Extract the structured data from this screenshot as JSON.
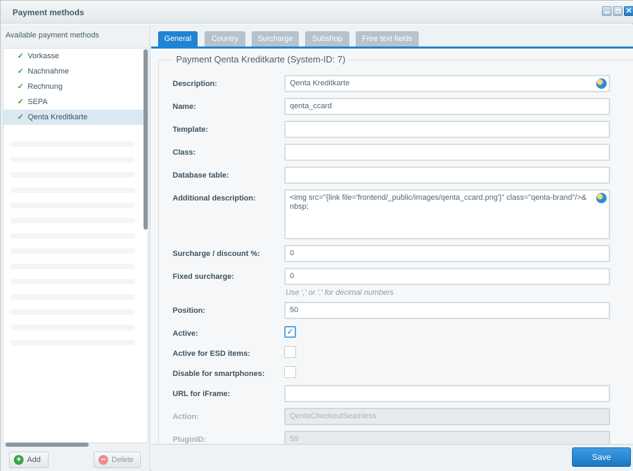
{
  "window": {
    "title": "Payment methods"
  },
  "left_panel": {
    "heading": "Available payment methods",
    "items": [
      {
        "label": "Vorkasse"
      },
      {
        "label": "Nachnahme"
      },
      {
        "label": "Rechnung"
      },
      {
        "label": "SEPA"
      },
      {
        "label": "Qenta Kreditkarte"
      }
    ],
    "add_label": "Add",
    "delete_label": "Delete"
  },
  "tabs": [
    {
      "label": "General"
    },
    {
      "label": "Country"
    },
    {
      "label": "Surcharge"
    },
    {
      "label": "Subshop"
    },
    {
      "label": "Free text fields"
    }
  ],
  "form": {
    "legend": "Payment Qenta Kreditkarte (System-ID: 7)",
    "description": {
      "label": "Description:",
      "value": "Qenta Kreditkarte"
    },
    "name": {
      "label": "Name:",
      "value": "qenta_ccard"
    },
    "template": {
      "label": "Template:",
      "value": ""
    },
    "class": {
      "label": "Class:",
      "value": ""
    },
    "database_table": {
      "label": "Database table:",
      "value": ""
    },
    "additional_description": {
      "label": "Additional description:",
      "value": "<img src=\"{link file='frontend/_public/images/qenta_ccard.png'}\" class=\"qenta-brand\"/>&nbsp;"
    },
    "surcharge_discount": {
      "label": "Surcharge / discount %:",
      "value": "0"
    },
    "fixed_surcharge": {
      "label": "Fixed surcharge:",
      "value": "0",
      "help": "Use ',' or '.' for decimal numbers"
    },
    "position": {
      "label": "Position:",
      "value": "50"
    },
    "active": {
      "label": "Active:",
      "checked": true
    },
    "active_esd": {
      "label": "Active for ESD items:",
      "checked": false
    },
    "disable_smartphones": {
      "label": "Disable for smartphones:",
      "checked": false
    },
    "url_iframe": {
      "label": "URL for iFrame:",
      "value": ""
    },
    "action": {
      "label": "Action:",
      "value": "QentaCheckoutSeamless"
    },
    "plugin_id": {
      "label": "PluginID:",
      "value": "59"
    }
  },
  "footer": {
    "save_label": "Save"
  },
  "colors": {
    "accent": "#1f84d3",
    "check": "#2e9e3e"
  }
}
